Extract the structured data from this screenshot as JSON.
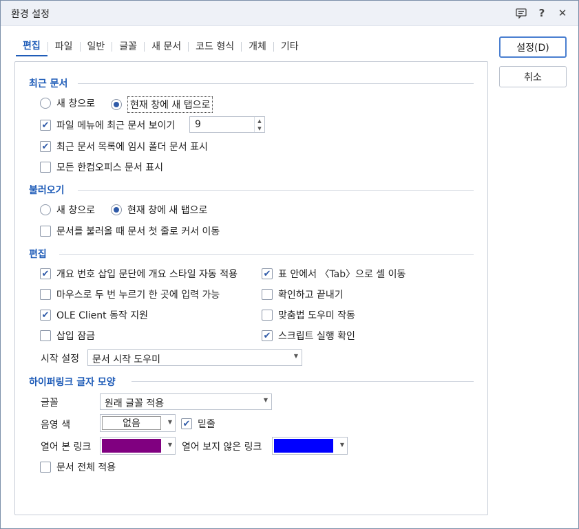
{
  "title": "환경 설정",
  "titlebar_icons": {
    "help": "?",
    "close": "✕"
  },
  "tabs": [
    "편집",
    "파일",
    "일반",
    "글꼴",
    "새 문서",
    "코드 형식",
    "개체",
    "기타"
  ],
  "buttons": {
    "ok": "설정(D)",
    "cancel": "취소"
  },
  "recent": {
    "title": "최근 문서",
    "radio_new_window": "새 창으로",
    "radio_new_tab": "현재 창에 새 탭으로",
    "show_in_menu": "파일 메뉴에 최근 문서 보이기",
    "show_in_menu_count": "9",
    "show_temp": "최근 문서 목록에 임시 폴더 문서 표시",
    "show_all": "모든 한컴오피스 문서 표시"
  },
  "open": {
    "title": "불러오기",
    "radio_new_window": "새 창으로",
    "radio_new_tab": "현재 창에 새 탭으로",
    "cursor_first_line": "문서를 불러올 때 문서 첫 줄로 커서 이동"
  },
  "edit": {
    "title": "편집",
    "outline_style": "개요 번호 삽입 문단에 개요 스타일 자동 적용",
    "tab_in_table": "표 안에서 〈Tab〉으로 셀 이동",
    "double_click_input": "마우스로 두 번 누르기 한 곳에 입력 가능",
    "confirm_exit": "확인하고 끝내기",
    "ole_client": "OLE Client 동작 지원",
    "spell_helper": "맞춤법 도우미 작동",
    "insert_lock": "삽입 잠금",
    "script_confirm": "스크립트 실행 확인",
    "start_label": "시작 설정",
    "start_value": "문서 시작 도우미"
  },
  "hyperlink": {
    "title": "하이퍼링크 글자 모양",
    "font_label": "글꼴",
    "font_value": "원래 글꼴 적용",
    "shade_label": "음영 색",
    "shade_value": "없음",
    "underline": "밑줄",
    "visited_label": "열어 본 링크",
    "unvisited_label": "열어 보지 않은 링크",
    "visited_color": "#800080",
    "unvisited_color": "#0000ff",
    "apply_all": "문서 전체 적용"
  }
}
